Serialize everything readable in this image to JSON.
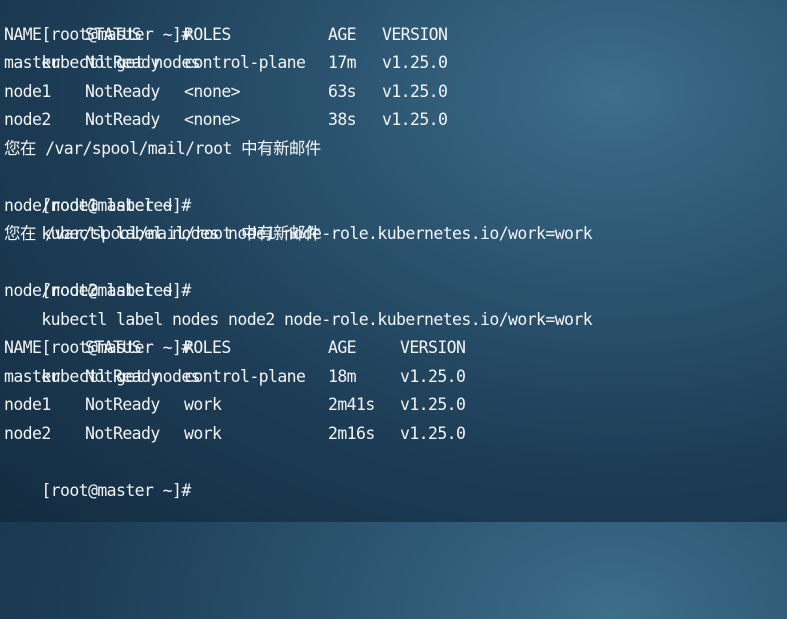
{
  "terminal": {
    "prompt": "[root@master ~]#",
    "commands": {
      "get_nodes_1": "kubectl get nodes",
      "label_node1": "kubectl label nodes node1 node-role.kubernetes.io/work=work",
      "label_node2": "kubectl label nodes node2 node-role.kubernetes.io/work=work",
      "get_nodes_2": "kubectl get nodes"
    },
    "mail_notice": "您在 /var/spool/mail/root 中有新邮件",
    "outputs": {
      "node1_labeled": "node/node1 labeled",
      "node2_labeled": "node/node2 labeled"
    },
    "table1": {
      "headers": [
        "NAME",
        "STATUS",
        "ROLES",
        "AGE",
        "VERSION"
      ],
      "rows": [
        [
          "master",
          "NotReady",
          "control-plane",
          "17m",
          "v1.25.0"
        ],
        [
          "node1",
          "NotReady",
          "<none>",
          "63s",
          "v1.25.0"
        ],
        [
          "node2",
          "NotReady",
          "<none>",
          "38s",
          "v1.25.0"
        ]
      ]
    },
    "table2": {
      "headers": [
        "NAME",
        "STATUS",
        "ROLES",
        "AGE",
        "VERSION"
      ],
      "rows": [
        [
          "master",
          "NotReady",
          "control-plane",
          "18m",
          "v1.25.0"
        ],
        [
          "node1",
          "NotReady",
          "work",
          "2m41s",
          "v1.25.0"
        ],
        [
          "node2",
          "NotReady",
          "work",
          "2m16s",
          "v1.25.0"
        ]
      ]
    }
  }
}
